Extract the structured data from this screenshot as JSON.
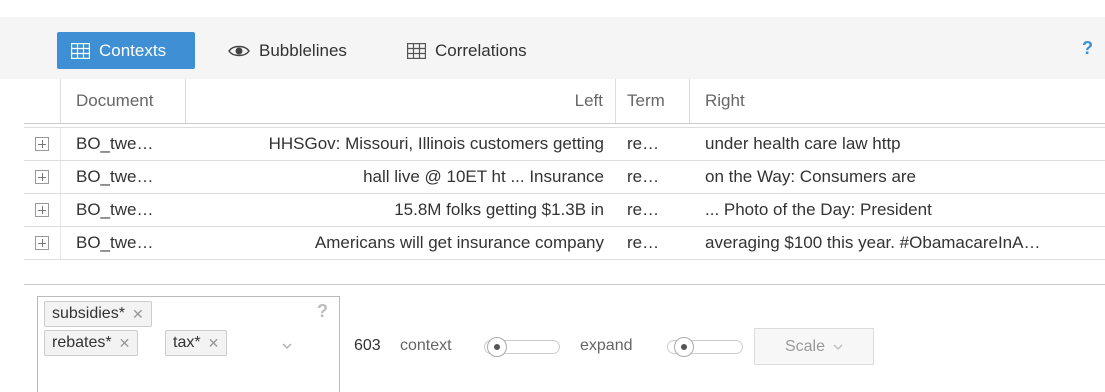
{
  "toolbar": {
    "tabs": [
      {
        "label": "Contexts",
        "icon": "table-icon",
        "active": true
      },
      {
        "label": "Bubblelines",
        "icon": "eye-icon",
        "active": false
      },
      {
        "label": "Correlations",
        "icon": "table-icon",
        "active": false
      }
    ],
    "help": "?",
    "accent_color": "#3e8fd4"
  },
  "table": {
    "columns": [
      "Document",
      "Left",
      "Term",
      "Right"
    ],
    "rows": [
      {
        "document": "BO_twe…",
        "left": "HHSGov: Missouri, Illinois customers getting",
        "term": "re…",
        "right": "under health care law http"
      },
      {
        "document": "BO_twe…",
        "left": "hall live @ 10ET ht ... Insurance",
        "term": "re…",
        "right": "on the Way: Consumers are"
      },
      {
        "document": "BO_twe…",
        "left": "15.8M folks getting $1.3B in",
        "term": "re…",
        "right": "... Photo of the Day: President"
      },
      {
        "document": "BO_twe…",
        "left": "Americans will get insurance company",
        "term": "re…",
        "right": "averaging $100 this year. #ObamacareInA…"
      }
    ]
  },
  "terms": {
    "tags": [
      "subsidies*",
      "rebates*",
      "tax*"
    ],
    "help": "?"
  },
  "controls": {
    "count": "603",
    "context_label": "context",
    "expand_label": "expand",
    "scale_label": "Scale"
  }
}
